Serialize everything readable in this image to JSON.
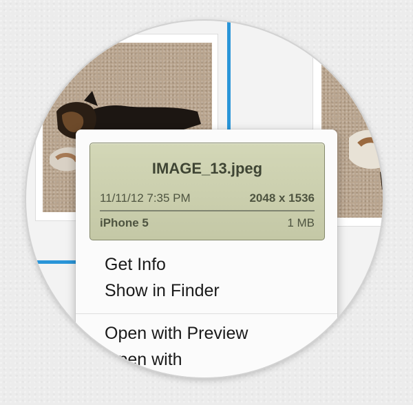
{
  "info_card": {
    "file_name": "IMAGE_13.jpeg",
    "date_time": "11/11/12 7:35 PM",
    "dimensions": "2048 x 1536",
    "device": "iPhone 5",
    "file_size": "1 MB"
  },
  "menu": {
    "items_group1": [
      {
        "label": "Get Info"
      },
      {
        "label": "Show in Finder"
      }
    ],
    "items_group2": [
      {
        "label": "Open with Preview"
      },
      {
        "label": "Open with"
      }
    ]
  },
  "colors": {
    "accent_blue": "#2a95d8",
    "card_bg": "#ccd0ae",
    "card_border": "#83876a"
  }
}
